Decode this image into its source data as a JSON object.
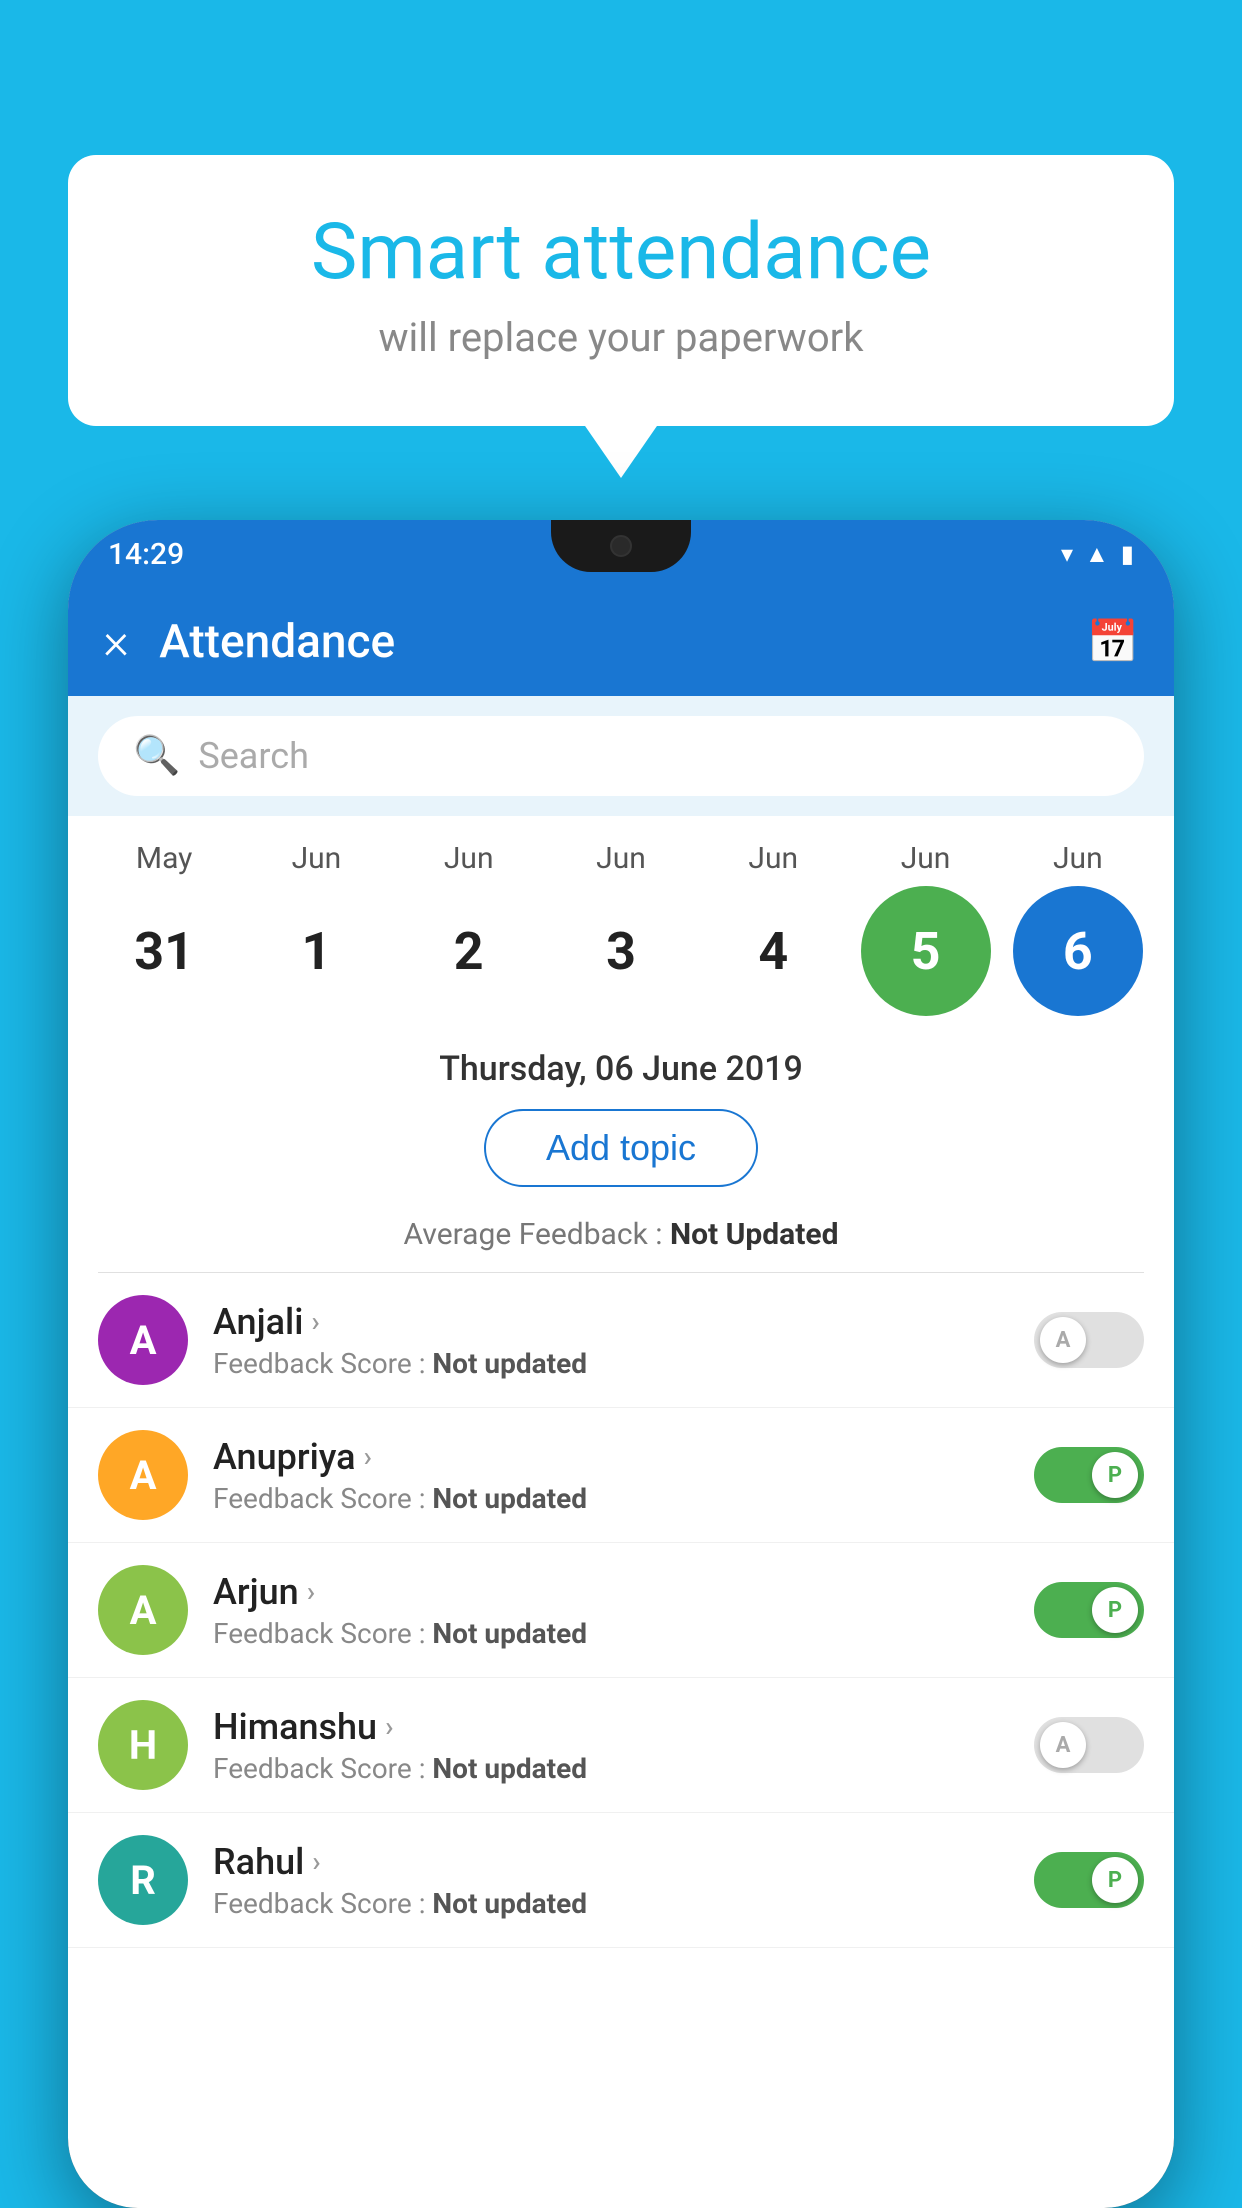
{
  "background_color": "#1ab8e8",
  "bubble": {
    "title": "Smart attendance",
    "subtitle": "will replace your paperwork"
  },
  "status_bar": {
    "time": "14:29",
    "icons": [
      "wifi",
      "signal",
      "battery"
    ]
  },
  "app_bar": {
    "title": "Attendance",
    "close_label": "×",
    "calendar_icon": "📅"
  },
  "search": {
    "placeholder": "Search"
  },
  "calendar": {
    "months": [
      "May",
      "Jun",
      "Jun",
      "Jun",
      "Jun",
      "Jun",
      "Jun"
    ],
    "dates": [
      "31",
      "1",
      "2",
      "3",
      "4",
      "5",
      "6"
    ],
    "today_index": 5,
    "selected_index": 6
  },
  "selected_date_label": "Thursday, 06 June 2019",
  "add_topic_label": "Add topic",
  "avg_feedback": {
    "label": "Average Feedback : ",
    "value": "Not Updated"
  },
  "students": [
    {
      "name": "Anjali",
      "avatar_letter": "A",
      "avatar_color": "#9c27b0",
      "feedback_label": "Feedback Score : ",
      "feedback_value": "Not updated",
      "toggle": "off",
      "toggle_letter": "A"
    },
    {
      "name": "Anupriya",
      "avatar_letter": "A",
      "avatar_color": "#ffa726",
      "feedback_label": "Feedback Score : ",
      "feedback_value": "Not updated",
      "toggle": "on",
      "toggle_letter": "P"
    },
    {
      "name": "Arjun",
      "avatar_letter": "A",
      "avatar_color": "#8bc34a",
      "feedback_label": "Feedback Score : ",
      "feedback_value": "Not updated",
      "toggle": "on",
      "toggle_letter": "P"
    },
    {
      "name": "Himanshu",
      "avatar_letter": "H",
      "avatar_color": "#8bc34a",
      "feedback_label": "Feedback Score : ",
      "feedback_value": "Not updated",
      "toggle": "off",
      "toggle_letter": "A"
    },
    {
      "name": "Rahul",
      "avatar_letter": "R",
      "avatar_color": "#26a69a",
      "feedback_label": "Feedback Score : ",
      "feedback_value": "Not updated",
      "toggle": "on",
      "toggle_letter": "P"
    }
  ]
}
